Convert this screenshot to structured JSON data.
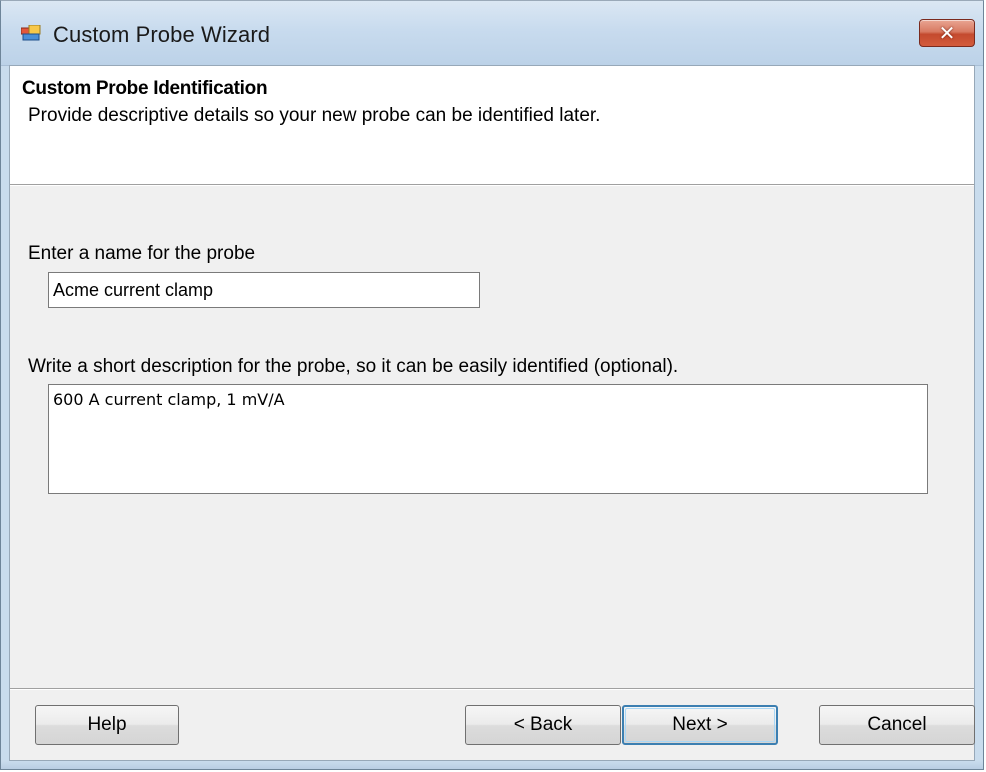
{
  "window": {
    "title": "Custom Probe Wizard",
    "app_icon": "probe-window-icon",
    "close_glyph": "✕"
  },
  "header": {
    "title": "Custom Probe Identification",
    "subtitle": "Provide descriptive details so your new probe can be identified later."
  },
  "form": {
    "name_label": "Enter a name for the probe",
    "name_value": "Acme current clamp",
    "description_label": "Write a short description for the probe, so it can be easily identified (optional).",
    "description_value": "600 A current clamp, 1 mV/A"
  },
  "buttons": {
    "help": "Help",
    "back": "< Back",
    "next": "Next >",
    "cancel": "Cancel"
  },
  "colors": {
    "titlebar": "#c8dbee",
    "close_button": "#c44a2e",
    "default_button_border": "#3c7fb1",
    "dialog_background": "#f0f0f0"
  }
}
